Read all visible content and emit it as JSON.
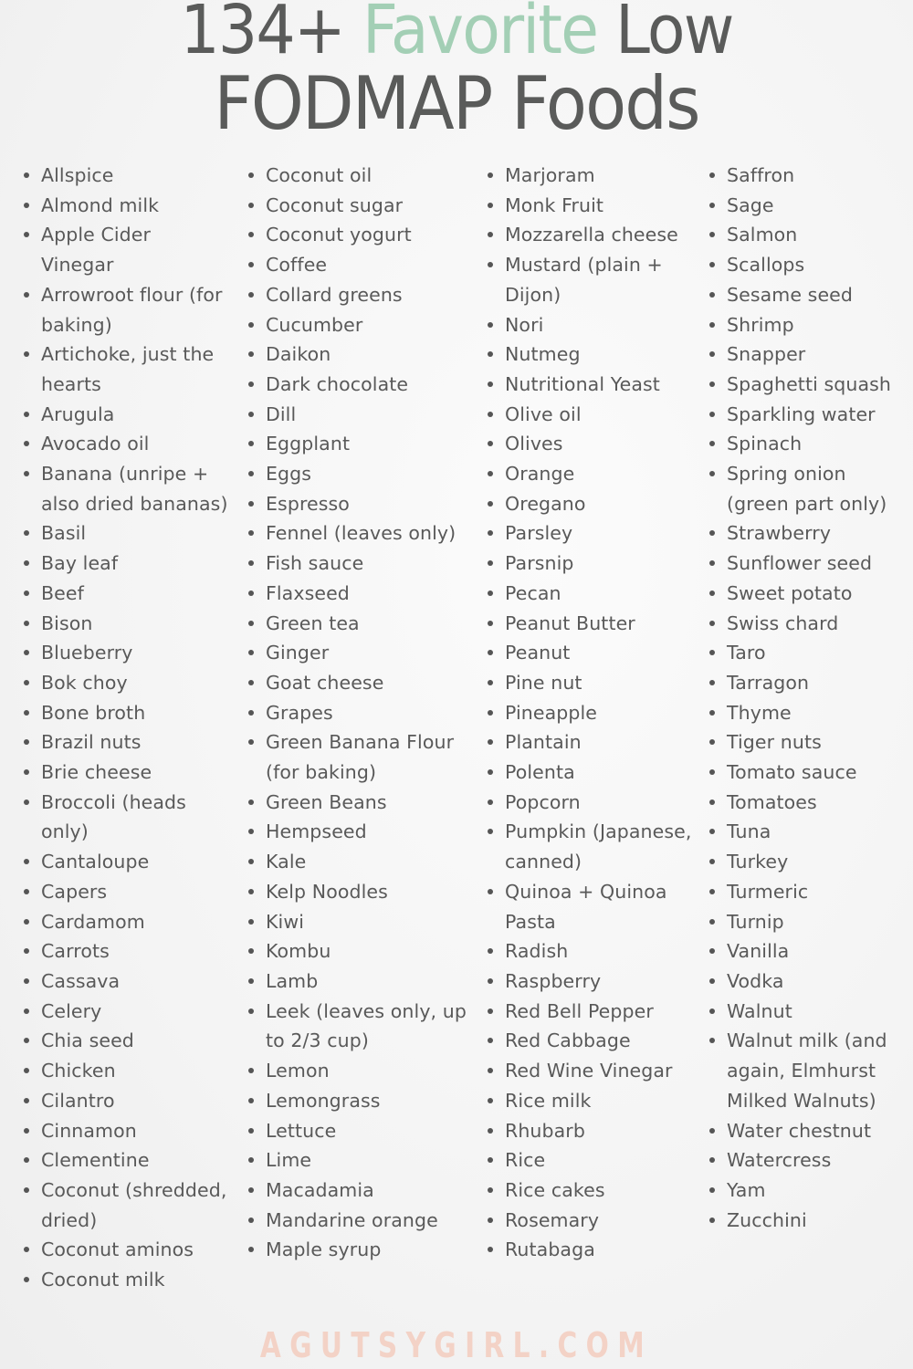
{
  "title": {
    "count": "134+",
    "accent": "Favorite",
    "rest_line1": "Low",
    "line2": "FODMAP Foods"
  },
  "colors": {
    "accent": "#a3cfb5",
    "text": "#5a5b5a",
    "footer": "#f3d2c6"
  },
  "columns": [
    {
      "items": [
        "Allspice",
        "Almond milk",
        "Apple Cider Vinegar",
        "Arrowroot flour (for baking)",
        "Artichoke, just the hearts",
        "Arugula",
        "Avocado oil",
        "Banana (unripe + also dried bananas)",
        "Basil",
        "Bay leaf",
        "Beef",
        "Bison",
        "Blueberry",
        "Bok choy",
        "Bone broth",
        "Brazil nuts",
        "Brie cheese",
        "Broccoli (heads only)",
        "Cantaloupe",
        "Capers",
        "Cardamom",
        "Carrots",
        "Cassava",
        "Celery",
        "Chia seed",
        "Chicken",
        "Cilantro",
        "Cinnamon",
        "Clementine",
        "Coconut (shredded, dried)",
        "Coconut aminos",
        "Coconut milk"
      ]
    },
    {
      "items": [
        "Coconut oil",
        "Coconut sugar",
        "Coconut yogurt",
        "Coffee",
        "Collard greens",
        "Cucumber",
        "Daikon",
        "Dark chocolate",
        "Dill",
        "Eggplant",
        "Eggs",
        "Espresso",
        "Fennel (leaves only)",
        "Fish sauce",
        "Flaxseed",
        "Green tea",
        "Ginger",
        "Goat cheese",
        "Grapes",
        "Green Banana Flour (for baking)",
        "Green Beans",
        "Hempseed",
        "Kale",
        "Kelp Noodles",
        "Kiwi",
        "Kombu",
        "Lamb",
        "Leek (leaves only, up to 2/3 cup)",
        "Lemon",
        "Lemongrass",
        "Lettuce",
        "Lime",
        "Macadamia",
        "Mandarine orange",
        "Maple syrup"
      ]
    },
    {
      "items": [
        "Marjoram",
        "Monk Fruit",
        "Mozzarella cheese",
        "Mustard (plain + Dijon)",
        "Nori",
        "Nutmeg",
        "Nutritional Yeast",
        "Olive oil",
        "Olives",
        "Orange",
        "Oregano",
        "Parsley",
        "Parsnip",
        "Pecan",
        "Peanut Butter",
        "Peanut",
        "Pine nut",
        "Pineapple",
        "Plantain",
        "Polenta",
        "Popcorn",
        "Pumpkin (Japanese, canned)",
        "Quinoa + Quinoa Pasta",
        "Radish",
        "Raspberry",
        "Red Bell Pepper",
        "Red Cabbage",
        "Red Wine Vinegar",
        "Rice milk",
        "Rhubarb",
        "Rice",
        "Rice cakes",
        "Rosemary",
        "Rutabaga"
      ]
    },
    {
      "items": [
        "Saffron",
        "Sage",
        "Salmon",
        "Scallops",
        "Sesame seed",
        "Shrimp",
        "Snapper",
        "Spaghetti squash",
        "Sparkling water",
        "Spinach",
        "Spring onion (green part only)",
        "Strawberry",
        "Sunflower seed",
        "Sweet potato",
        "Swiss chard",
        "Taro",
        "Tarragon",
        "Thyme",
        "Tiger nuts",
        "Tomato sauce",
        "Tomatoes",
        "Tuna",
        "Turkey",
        "Turmeric",
        "Turnip",
        "Vanilla",
        "Vodka",
        "Walnut",
        "Walnut milk (and again, Elmhurst Milked Walnuts)",
        "Water chestnut",
        "Watercress",
        "Yam",
        "Zucchini"
      ]
    }
  ],
  "footer": {
    "site": "AGUTSYGIRL.COM"
  }
}
